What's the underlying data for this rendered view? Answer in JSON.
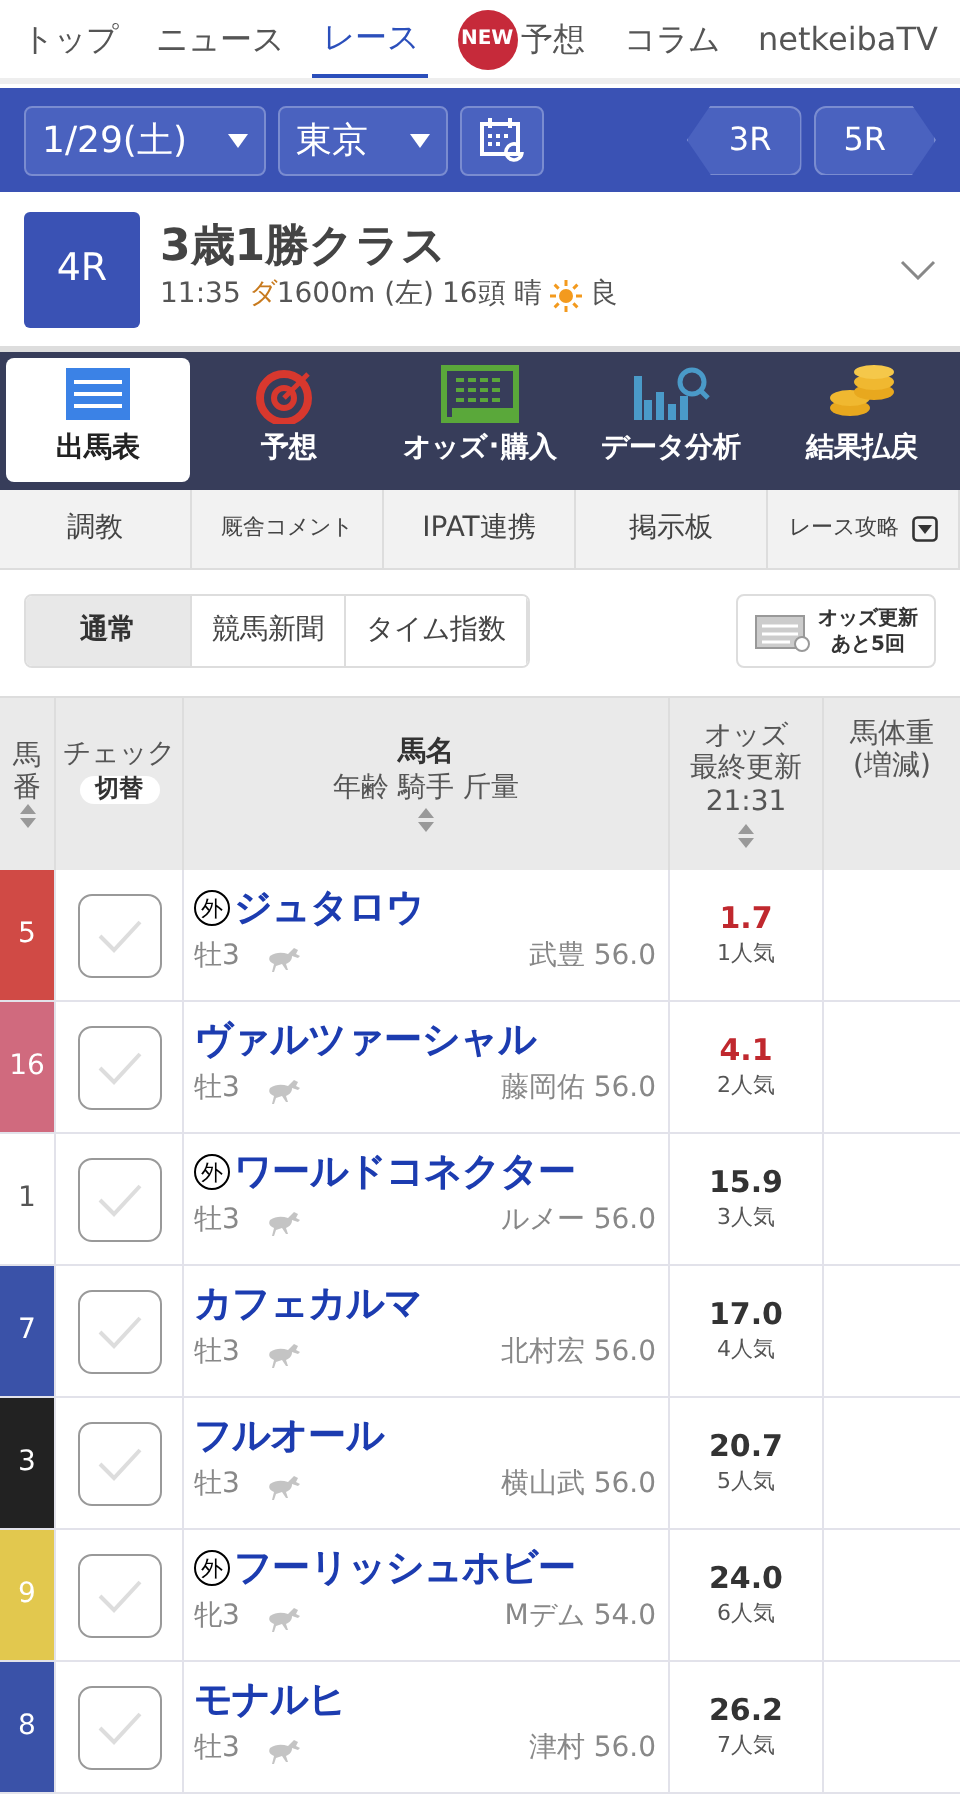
{
  "top_nav": [
    {
      "label": "トップ",
      "selected": false
    },
    {
      "label": "ニュース",
      "selected": false
    },
    {
      "label": "レース",
      "selected": true
    },
    {
      "label": "予想",
      "selected": false,
      "badge": "NEW"
    },
    {
      "label": "コラム",
      "selected": false
    },
    {
      "label": "netkeibaTV",
      "selected": false
    }
  ],
  "race_bar": {
    "date": "1/29(土)",
    "venue": "東京",
    "prev": "3R",
    "next": "5R"
  },
  "race": {
    "number": "4R",
    "title": "3歳1勝クラス",
    "time": "11:35",
    "surface": "ダ",
    "distance": "1600m (左)",
    "runners": "16頭",
    "weather": "晴",
    "condition": "良"
  },
  "main_tabs": [
    {
      "label": "出馬表",
      "selected": true
    },
    {
      "label": "予想",
      "selected": false
    },
    {
      "label": "オッズ･購入",
      "selected": false
    },
    {
      "label": "データ分析",
      "selected": false
    },
    {
      "label": "結果払戻",
      "selected": false
    }
  ],
  "sub_tabs": [
    "調教",
    "厩舎コメント",
    "IPAT連携",
    "掲示板",
    "レース攻略"
  ],
  "view_modes": [
    {
      "label": "通常",
      "selected": true
    },
    {
      "label": "競馬新聞",
      "selected": false
    },
    {
      "label": "タイム指数",
      "selected": false
    }
  ],
  "odds_update": {
    "line_1": "オッズ更新",
    "line_2": "あと5回"
  },
  "table": {
    "columns": [
      {
        "lines": [
          "馬",
          "番"
        ]
      },
      {
        "title": "チェック",
        "button": "切替"
      },
      {
        "title": "馬名",
        "subtitle": "年齢 騎手 斤量"
      },
      {
        "lines": [
          "オッズ",
          "最終更新",
          "21:31"
        ]
      },
      {
        "lines": [
          "馬体重",
          "(増減)"
        ]
      }
    ],
    "rows": [
      {
        "number": "5",
        "color": "#d04a45",
        "mark": "外",
        "name": "ジュタロウ",
        "sex_age": "牡3",
        "jockey": "武豊",
        "weight": "56.0",
        "odds": "1.7",
        "popularity": "1人気",
        "favorite": true,
        "checked": false
      },
      {
        "number": "16",
        "color": "#d06a7e",
        "name": "ヴァルツァーシャル",
        "sex_age": "牡3",
        "jockey": "藤岡佑",
        "weight": "56.0",
        "odds": "4.1",
        "popularity": "2人気",
        "favorite": true,
        "checked": false
      },
      {
        "number": "1",
        "color": "#ffffff",
        "mark": "外",
        "name": "ワールドコネクター",
        "sex_age": "牡3",
        "jockey": "ルメー",
        "weight": "56.0",
        "odds": "15.9",
        "popularity": "3人気",
        "favorite": false,
        "checked": false
      },
      {
        "number": "7",
        "color": "#3a52a8",
        "name": "カフェカルマ",
        "sex_age": "牡3",
        "jockey": "北村宏",
        "weight": "56.0",
        "odds": "17.0",
        "popularity": "4人気",
        "favorite": false,
        "checked": false
      },
      {
        "number": "3",
        "color": "#222222",
        "name": "フルオール",
        "sex_age": "牡3",
        "jockey": "横山武",
        "weight": "56.0",
        "odds": "20.7",
        "popularity": "5人気",
        "favorite": false,
        "checked": false
      },
      {
        "number": "9",
        "color": "#e2c84e",
        "mark": "外",
        "name": "フーリッシュホビー",
        "sex_age": "牝3",
        "jockey": "Mデム",
        "weight": "54.0",
        "odds": "24.0",
        "popularity": "6人気",
        "favorite": false,
        "checked": false
      },
      {
        "number": "8",
        "color": "#3a52a8",
        "name": "モナルヒ",
        "sex_age": "牡3",
        "jockey": "津村",
        "weight": "56.0",
        "odds": "26.2",
        "popularity": "7人気",
        "favorite": false,
        "checked": false
      }
    ]
  }
}
